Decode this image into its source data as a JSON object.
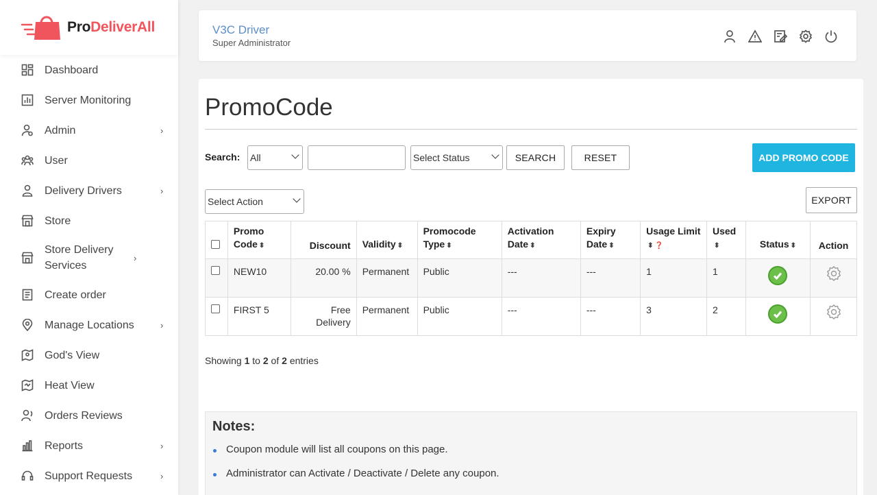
{
  "brand": {
    "prefix": "Pro",
    "name": "DeliverAll",
    "color": "#f0545c"
  },
  "sidebar": {
    "items": [
      {
        "label": "Dashboard",
        "icon": "dashboard-icon",
        "has_submenu": false
      },
      {
        "label": "Server Monitoring",
        "icon": "chart-icon",
        "has_submenu": false
      },
      {
        "label": "Admin",
        "icon": "admin-icon",
        "has_submenu": true
      },
      {
        "label": "User",
        "icon": "users-icon",
        "has_submenu": false
      },
      {
        "label": "Delivery Drivers",
        "icon": "driver-icon",
        "has_submenu": true
      },
      {
        "label": "Store",
        "icon": "store-icon",
        "has_submenu": false
      },
      {
        "label": "Store Delivery Services",
        "icon": "store-icon",
        "has_submenu": true
      },
      {
        "label": "Create order",
        "icon": "document-icon",
        "has_submenu": false
      },
      {
        "label": "Manage Locations",
        "icon": "location-icon",
        "has_submenu": true
      },
      {
        "label": "God's View",
        "icon": "map-pin-icon",
        "has_submenu": false
      },
      {
        "label": "Heat View",
        "icon": "heat-map-icon",
        "has_submenu": false
      },
      {
        "label": "Orders Reviews",
        "icon": "review-icon",
        "has_submenu": false
      },
      {
        "label": "Reports",
        "icon": "bar-chart-icon",
        "has_submenu": true
      },
      {
        "label": "Support Requests",
        "icon": "headset-icon",
        "has_submenu": true
      }
    ]
  },
  "header": {
    "user_name": "V3C Driver",
    "user_role": "Super Administrator",
    "icons": [
      "profile-icon",
      "alert-icon",
      "edit-icon",
      "settings-icon",
      "power-icon"
    ]
  },
  "page": {
    "title": "PromoCode",
    "search_label": "Search:",
    "search_field_value": "All",
    "search_input_value": "",
    "status_select_value": "Select Status",
    "search_button": "SEARCH",
    "reset_button": "RESET",
    "add_button": "ADD PROMO CODE",
    "action_select_value": "Select Action",
    "export_button": "EXPORT"
  },
  "table": {
    "headers": {
      "promo_code_1": "Promo",
      "promo_code_2": "Code",
      "discount": "Discount",
      "validity": "Validity",
      "type_1": "Promocode",
      "type_2": "Type",
      "activation_1": "Activation",
      "activation_2": "Date",
      "expiry_1": "Expiry",
      "expiry_2": "Date",
      "usage_limit": "Usage Limit",
      "used": "Used",
      "status": "Status",
      "action": "Action"
    },
    "rows": [
      {
        "code": "NEW10",
        "discount": "20.00 %",
        "validity": "Permanent",
        "type": "Public",
        "activation": "---",
        "expiry": "---",
        "usage_limit": "1",
        "used": "1",
        "status": "active"
      },
      {
        "code": "FIRST 5",
        "discount": "Free Delivery",
        "validity": "Permanent",
        "type": "Public",
        "activation": "---",
        "expiry": "---",
        "usage_limit": "3",
        "used": "2",
        "status": "active"
      }
    ]
  },
  "footer": {
    "showing_prefix": "Showing",
    "from": "1",
    "to_word": "to",
    "to": "2",
    "of_word": "of",
    "total": "2",
    "entries_word": "entries"
  },
  "notes": {
    "title": "Notes:",
    "items": [
      "Coupon module will list all coupons on this page.",
      "Administrator can Activate / Deactivate / Delete any coupon."
    ]
  },
  "colors": {
    "accent": "#1fb5e0",
    "header_name": "#5b8ec9",
    "status_active": "#6cc04a"
  }
}
